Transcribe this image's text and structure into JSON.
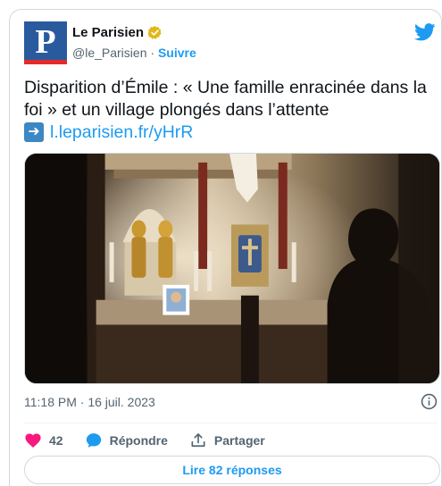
{
  "account": {
    "name": "Le Parisien",
    "handle": "@le_Parisien",
    "separator": "·",
    "follow_label": "Suivre",
    "avatar_letter": "P"
  },
  "tweet": {
    "text": "Disparition d’Émile : « Une famille enracinée dans la foi » et un village plongés dans l’attente",
    "link_text": "l.leparisien.fr/yHrR",
    "link_prefix_icon": "right-arrow-emoji-icon",
    "timestamp": "11:18 PM · 16 juil. 2023"
  },
  "actions": {
    "likes_count": "42",
    "reply_label": "Répondre",
    "share_label": "Partager"
  },
  "replies_button_label": "Lire 82 réponses",
  "colors": {
    "accent": "#1d9bf0",
    "like": "#f91880",
    "brand_blue": "#2a5a9e",
    "brand_red": "#e32b2b",
    "verified_gold": "#e2b719"
  }
}
